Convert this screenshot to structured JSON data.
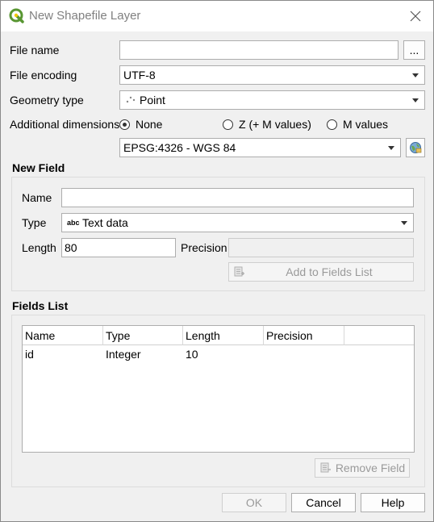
{
  "window": {
    "title": "New Shapefile Layer"
  },
  "form": {
    "file_name_label": "File name",
    "file_name_value": "",
    "browse_label": "...",
    "file_encoding_label": "File encoding",
    "file_encoding_value": "UTF-8",
    "geometry_type_label": "Geometry type",
    "geometry_type_value": "Point",
    "additional_dimensions_label": "Additional dimensions",
    "dimension_options": [
      "None",
      "Z (+ M values)",
      "M values"
    ],
    "dimension_selected": "None",
    "crs_value": "EPSG:4326 - WGS 84"
  },
  "new_field": {
    "group_title": "New Field",
    "name_label": "Name",
    "name_value": "",
    "type_label": "Type",
    "type_icon_text": "abc",
    "type_value": "Text data",
    "length_label": "Length",
    "length_value": "80",
    "precision_label": "Precision",
    "precision_value": "",
    "add_button_label": "Add to Fields List"
  },
  "fields_list": {
    "group_title": "Fields List",
    "columns": [
      "Name",
      "Type",
      "Length",
      "Precision"
    ],
    "rows": [
      [
        "id",
        "Integer",
        "10",
        ""
      ]
    ],
    "remove_button_label": "Remove Field"
  },
  "footer": {
    "ok_label": "OK",
    "cancel_label": "Cancel",
    "help_label": "Help"
  },
  "colors": {
    "qgis_green": "#589632",
    "qgis_yellow": "#f0c800"
  }
}
